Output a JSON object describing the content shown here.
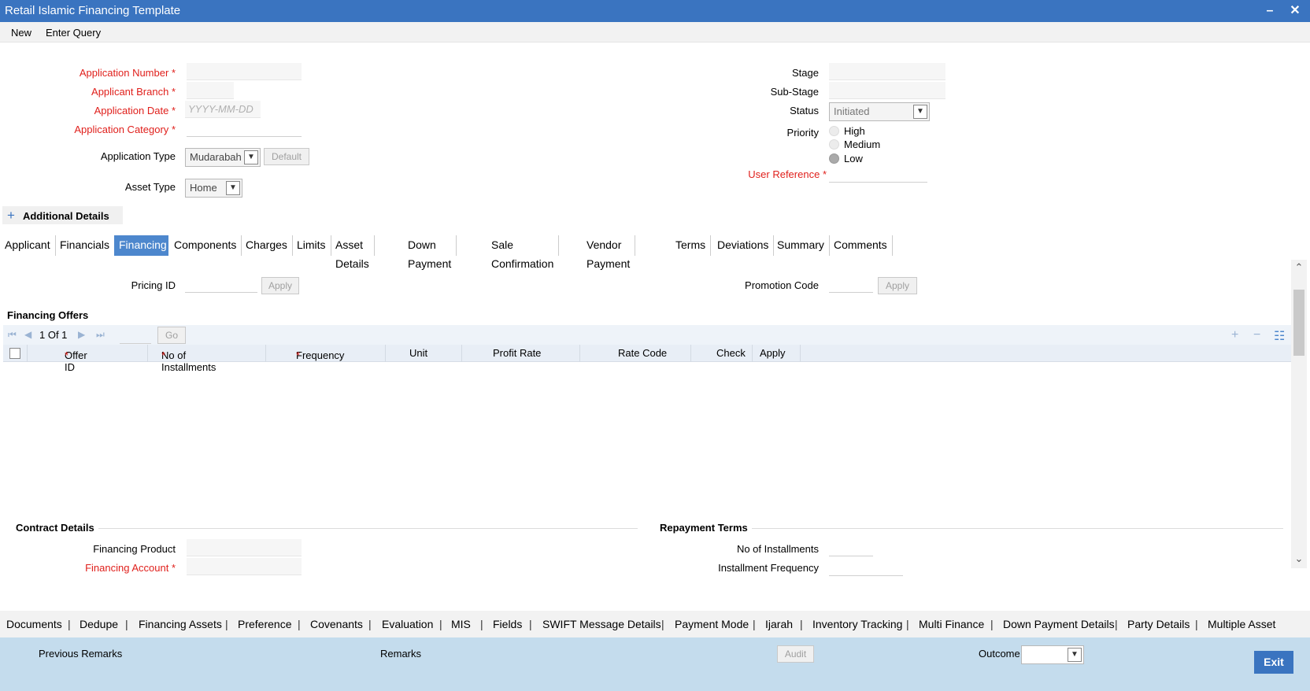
{
  "window": {
    "title": "Retail Islamic Financing Template",
    "minimize": "–",
    "close": "✕"
  },
  "menu": {
    "new": "New",
    "enter_query": "Enter Query"
  },
  "form": {
    "application_number": "Application Number",
    "applicant_branch": "Applicant Branch",
    "application_date": "Application Date",
    "application_date_placeholder": "YYYY-MM-DD",
    "application_category": "Application Category",
    "application_type": "Application Type",
    "application_type_value": "Mudarabah",
    "default_button": "Default",
    "asset_type": "Asset Type",
    "asset_type_value": "Home",
    "stage": "Stage",
    "sub_stage": "Sub-Stage",
    "status": "Status",
    "status_value": "Initiated",
    "priority": "Priority",
    "priority_options": [
      "High",
      "Medium",
      "Low"
    ],
    "priority_selected": "Low",
    "user_reference": "User Reference",
    "required_mark": "*"
  },
  "additional_details": {
    "icon": "plus-icon",
    "plus": "+",
    "label": "Additional Details"
  },
  "tabs": [
    "Applicant",
    "Financials",
    "Financing",
    "Components",
    "Charges",
    "Limits",
    "Asset Details",
    "Down Payment",
    "Sale Confirmation",
    "Vendor Payment",
    "Terms",
    "Deviations",
    "Summary",
    "Comments"
  ],
  "active_tab": "Financing",
  "financing": {
    "pricing_id": "Pricing ID",
    "apply": "Apply",
    "promotion_code": "Promotion Code",
    "offers_title": "Financing Offers",
    "pager": {
      "first": "⏮",
      "prev": "◀",
      "page_text": "1 Of 1",
      "next": "▶",
      "last": "⏭",
      "go": "Go"
    },
    "grid_icons": {
      "add": "+",
      "remove": "−",
      "columns": "☷"
    },
    "columns": [
      "Offer ID",
      "No of Installments",
      "Frequency",
      "Unit",
      "Profit Rate",
      "Rate Code",
      "Check",
      "Apply"
    ]
  },
  "contract_details": {
    "title": "Contract Details",
    "financing_product": "Financing Product",
    "financing_account": "Financing Account"
  },
  "repayment_terms": {
    "title": "Repayment Terms",
    "no_of_installments": "No of Installments",
    "installment_frequency": "Installment Frequency"
  },
  "scroll": {
    "up": "⌃",
    "down": "⌄"
  },
  "bottom_links": [
    "Documents",
    "Dedupe",
    "Financing Assets",
    "Preference",
    "Covenants",
    "Evaluation",
    "MIS",
    "Fields",
    "SWIFT Message Details",
    "Payment Mode",
    "Ijarah",
    "Inventory Tracking",
    "Multi Finance",
    "Down Payment Details",
    "Party Details",
    "Multiple Asset"
  ],
  "link_separator": "|",
  "footer": {
    "previous_remarks": "Previous Remarks",
    "remarks": "Remarks",
    "audit": "Audit",
    "outcome": "Outcome",
    "exit": "Exit"
  },
  "colors": {
    "title_bar": "#3a74c0",
    "active_tab": "#4d87cd",
    "required_label": "#e0201c",
    "footer": "#c4dced",
    "exit_button": "#3a74c0"
  }
}
